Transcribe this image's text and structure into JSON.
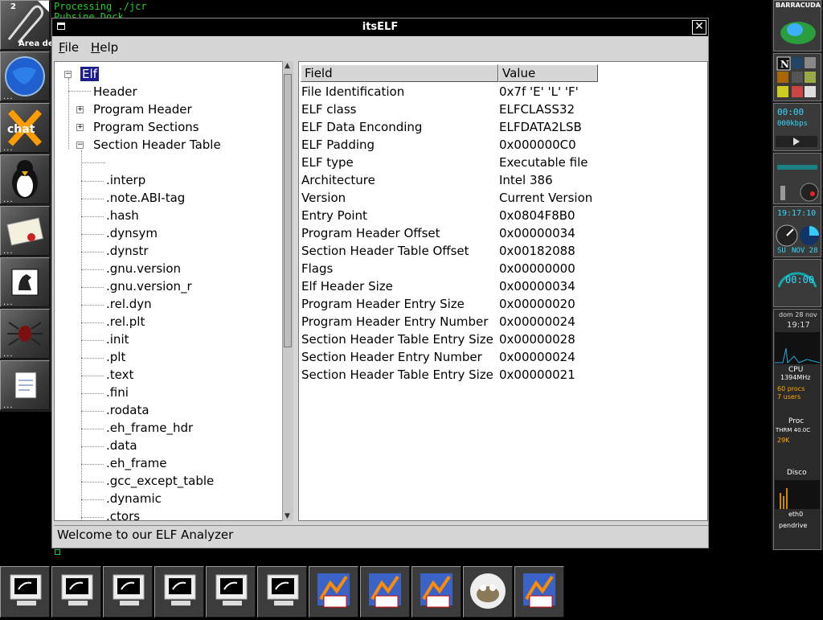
{
  "background": {
    "terminal_line1": "Processing ./jcr",
    "terminal_line2": "Pubsine Dock..."
  },
  "left_dock": {
    "workspace_number": "2",
    "workspace_label": "Area de",
    "items": [
      "paperclip-icon",
      "globe-icon",
      "xchat-icon",
      "penguin-icon",
      "mail-icon",
      "horse-icon",
      "spider-icon",
      "document-icon"
    ]
  },
  "right_dock": {
    "logo": "BARRACUDA",
    "time_display": "00:00",
    "bitrate": "000kbps",
    "clock": "19:17:10",
    "date_day": "SU",
    "date_month": "NOV 28",
    "uptime": "00:00",
    "date2": "dom 28 nov",
    "time2": "19:17",
    "cpu_label": "CPU",
    "cpu_freq": "1394MHz",
    "procs": "60 procs",
    "users": "7 users",
    "proc_label": "Proc",
    "therm": "THRM 40.0C",
    "mem": "29K",
    "disk_label": "Disco",
    "net_label": "eth0",
    "pendrive": "pendrive"
  },
  "window": {
    "title": "itsELF",
    "menu": {
      "file": "ile",
      "file_accel": "F",
      "help": "elp",
      "help_accel": "H"
    },
    "status": "Welcome to our ELF Analyzer"
  },
  "tree": {
    "root": "Elf",
    "level1": [
      "Header",
      "Program Header",
      "Program Sections",
      "Section Header Table"
    ],
    "sections": [
      ".interp",
      ".note.ABI-tag",
      ".hash",
      ".dynsym",
      ".dynstr",
      ".gnu.version",
      ".gnu.version_r",
      ".rel.dyn",
      ".rel.plt",
      ".init",
      ".plt",
      ".text",
      ".fini",
      ".rodata",
      ".eh_frame_hdr",
      ".data",
      ".eh_frame",
      ".gcc_except_table",
      ".dynamic",
      ".ctors"
    ]
  },
  "table": {
    "headers": [
      "Field",
      "Value"
    ],
    "rows": [
      [
        "File Identification",
        "0x7f 'E' 'L' 'F'"
      ],
      [
        "ELF class",
        "ELFCLASS32"
      ],
      [
        "ELF Data Enconding",
        "ELFDATA2LSB"
      ],
      [
        "ELF Padding",
        "0x000000C0"
      ],
      [
        "ELF type",
        "Executable file"
      ],
      [
        "Architecture",
        "Intel 386"
      ],
      [
        "Version",
        "Current Version"
      ],
      [
        "Entry Point",
        "0x0804F8B0"
      ],
      [
        "Program Header Offset",
        "0x00000034"
      ],
      [
        "Section Header Table Offset",
        "0x00182088"
      ],
      [
        "Flags",
        "0x00000000"
      ],
      [
        "Elf Header Size",
        "0x00000034"
      ],
      [
        "Program Header Entry Size",
        "0x00000020"
      ],
      [
        "Program Header Entry Number",
        "0x00000024"
      ],
      [
        "Section Header Table Entry Size",
        "0x00000028"
      ],
      [
        "Section Header Entry Number",
        "0x00000024"
      ],
      [
        "Section Header Table Entry Size",
        "0x00000021"
      ]
    ]
  },
  "taskbar": {
    "items": [
      "monitor-icon",
      "monitor-icon",
      "monitor-icon",
      "monitor-icon",
      "monitor-icon",
      "monitor-icon",
      "app-icon",
      "app-icon",
      "app-icon",
      "gimp-icon",
      "app-icon"
    ]
  },
  "colors": {
    "selection": "#1c1c8c",
    "terminal_text": "#22cc22",
    "window_bg": "#d6d6d6"
  }
}
